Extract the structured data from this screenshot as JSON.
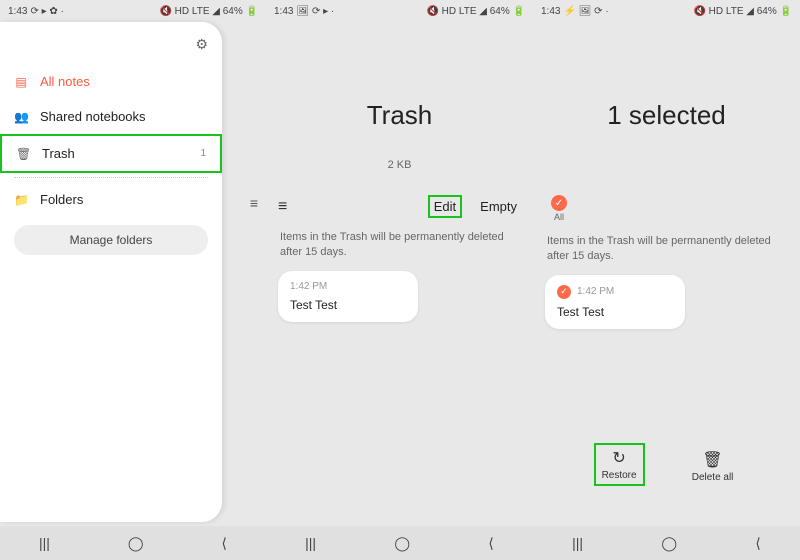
{
  "status": {
    "time": "1:43",
    "leftIcons": "⟳ ▸ ✿ ·",
    "leftIcons2": "1:43 🖼 ⟳ ▸ ·",
    "leftIcons3": "1:43 ⚡ 🖼 ⟳ ·",
    "rightIcons": "🔇 HD LTE ◢ 64% 🔋"
  },
  "drawer": {
    "allNotes": "All notes",
    "shared": "Shared notebooks",
    "trash": "Trash",
    "trashCount": "1",
    "folders": "Folders",
    "manage": "Manage folders"
  },
  "trash": {
    "title": "Trash",
    "size": "2 KB",
    "edit": "Edit",
    "empty": "Empty",
    "note": "Items in the Trash will be permanently deleted after 15 days.",
    "cardTime": "1:42 PM",
    "cardTitle": "Test Test"
  },
  "selected": {
    "title": "1 selected",
    "all": "All",
    "restore": "Restore",
    "deleteAll": "Delete all"
  },
  "nav": {
    "recent": "|||",
    "home": "◯",
    "back": "⟨"
  }
}
